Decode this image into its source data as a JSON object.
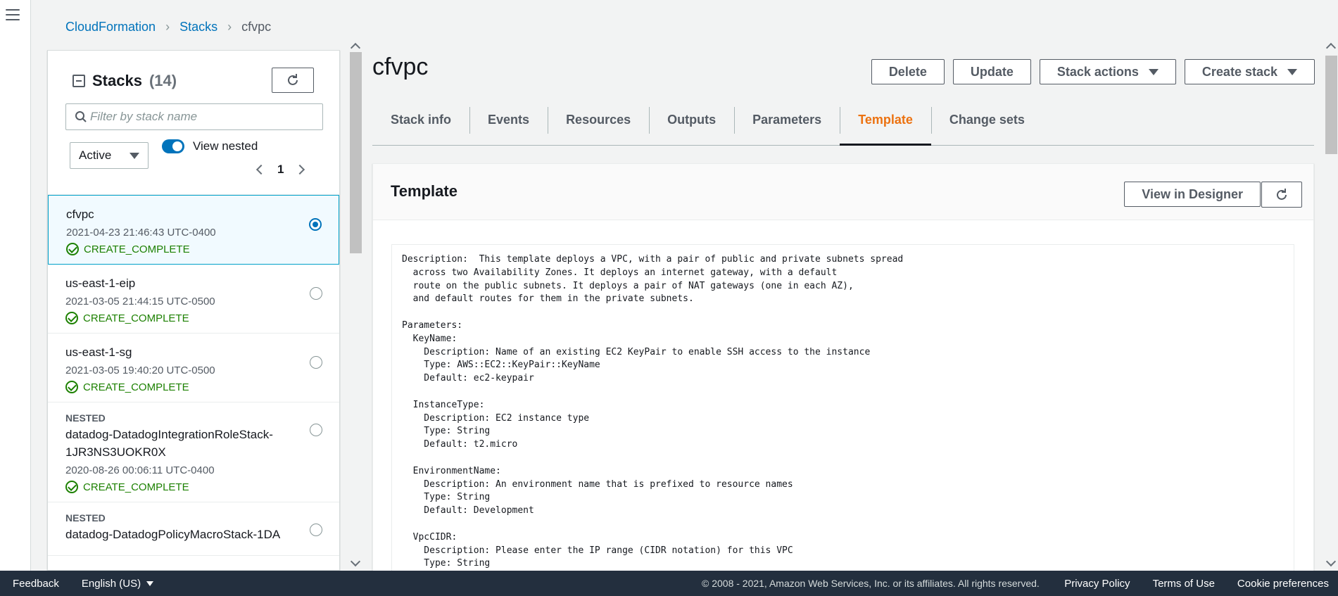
{
  "breadcrumb": {
    "items": [
      "CloudFormation",
      "Stacks"
    ],
    "current": "cfvpc"
  },
  "stacks_panel": {
    "title": "Stacks",
    "count": "(14)",
    "search_placeholder": "Filter by stack name",
    "filter_value": "Active",
    "view_nested_label": "View nested",
    "view_nested_on": true,
    "page": "1",
    "items": [
      {
        "nested": "",
        "name": "cfvpc",
        "date": "2021-04-23 21:46:43 UTC-0400",
        "status": "CREATE_COMPLETE",
        "selected": true
      },
      {
        "nested": "",
        "name": "us-east-1-eip",
        "date": "2021-03-05 21:44:15 UTC-0500",
        "status": "CREATE_COMPLETE",
        "selected": false
      },
      {
        "nested": "",
        "name": "us-east-1-sg",
        "date": "2021-03-05 19:40:20 UTC-0500",
        "status": "CREATE_COMPLETE",
        "selected": false
      },
      {
        "nested": "NESTED",
        "name": "datadog-DatadogIntegrationRoleStack-1JR3NS3UOKR0X",
        "date": "2020-08-26 00:06:11 UTC-0400",
        "status": "CREATE_COMPLETE",
        "selected": false
      },
      {
        "nested": "NESTED",
        "name": "datadog-DatadogPolicyMacroStack-1DA",
        "date": "",
        "status": "",
        "selected": false
      }
    ]
  },
  "stack": {
    "title": "cfvpc",
    "actions": {
      "delete": "Delete",
      "update": "Update",
      "stack_actions": "Stack actions",
      "create_stack": "Create stack"
    },
    "tabs": [
      "Stack info",
      "Events",
      "Resources",
      "Outputs",
      "Parameters",
      "Template",
      "Change sets"
    ],
    "active_tab": "Template"
  },
  "template": {
    "heading": "Template",
    "view_in_designer": "View in Designer",
    "lines": [
      "Description:  This template deploys a VPC, with a pair of public and private subnets spread",
      "  across two Availability Zones. It deploys an internet gateway, with a default",
      "  route on the public subnets. It deploys a pair of NAT gateways (one in each AZ),",
      "  and default routes for them in the private subnets.",
      "",
      "Parameters:",
      "  KeyName:",
      "    Description: Name of an existing EC2 KeyPair to enable SSH access to the instance",
      "    Type: AWS::EC2::KeyPair::KeyName",
      "    Default: ec2-keypair",
      "",
      "  InstanceType:",
      "    Description: EC2 instance type",
      "    Type: String",
      "    Default: t2.micro",
      "",
      "  EnvironmentName:",
      "    Description: An environment name that is prefixed to resource names",
      "    Type: String",
      "    Default: Development",
      "",
      "  VpcCIDR:",
      "    Description: Please enter the IP range (CIDR notation) for this VPC",
      "    Type: String"
    ]
  },
  "footer": {
    "feedback": "Feedback",
    "language": "English (US)",
    "copyright": "© 2008 - 2021, Amazon Web Services, Inc. or its affiliates. All rights reserved.",
    "links": [
      "Privacy Policy",
      "Terms of Use",
      "Cookie preferences"
    ]
  },
  "colors": {
    "link": "#0073bb",
    "active_tab": "#ec7211",
    "success": "#1d8102",
    "footer_bg": "#232f3e"
  },
  "icons": [
    "menu-icon",
    "chevron-right-icon",
    "collapse-icon",
    "refresh-icon",
    "search-icon",
    "caret-down-icon",
    "check-circle-icon",
    "radio-icon"
  ]
}
